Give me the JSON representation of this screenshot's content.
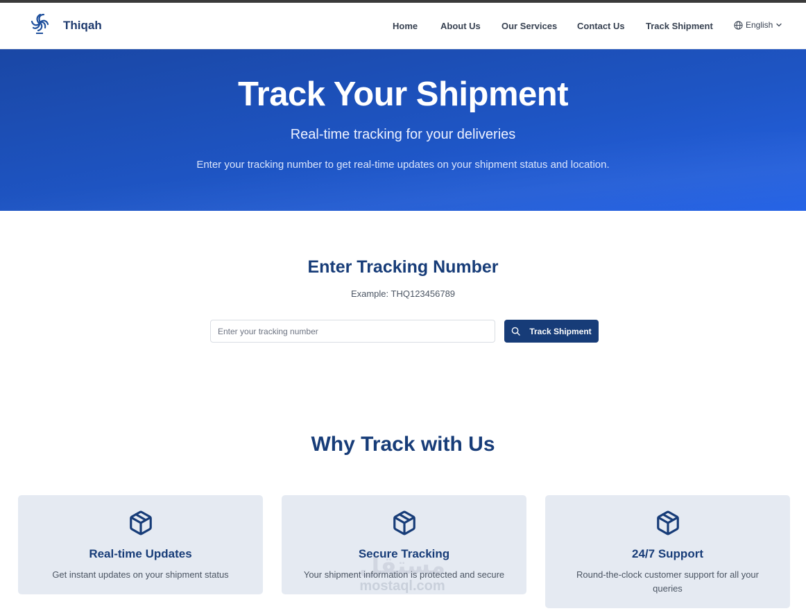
{
  "brand": {
    "name": "Thiqah"
  },
  "nav": {
    "items": [
      {
        "label": "Home"
      },
      {
        "label": "About Us"
      },
      {
        "label": "Our Services"
      },
      {
        "label": "Contact Us"
      },
      {
        "label": "Track Shipment"
      }
    ],
    "language": {
      "label": "English",
      "icon": "globe-icon"
    }
  },
  "hero": {
    "title": "Track Your Shipment",
    "subtitle": "Real-time tracking for your deliveries",
    "description": "Enter your tracking number to get real-time updates on your shipment status and location."
  },
  "tracking": {
    "title": "Enter Tracking Number",
    "example": "Example: THQ123456789",
    "input_value": "",
    "placeholder": "Enter your tracking number",
    "button_label": "Track Shipment",
    "button_icon": "search-icon"
  },
  "why": {
    "title": "Why Track with Us",
    "cards": [
      {
        "icon": "package-icon",
        "title": "Real-time Updates",
        "description": "Get instant updates on your shipment status"
      },
      {
        "icon": "package-icon",
        "title": "Secure Tracking",
        "description": "Your shipment information is protected and secure"
      },
      {
        "icon": "package-icon",
        "title": "24/7 Support",
        "description": "Round-the-clock customer support for all your queries"
      }
    ]
  },
  "watermark": {
    "arabic": "مستقل",
    "latin": "mostaql.com"
  },
  "colors": {
    "primary": "#173c78",
    "hero_start": "#1a47a5",
    "hero_end": "#2563e6",
    "card_bg": "#e5eaf2"
  }
}
